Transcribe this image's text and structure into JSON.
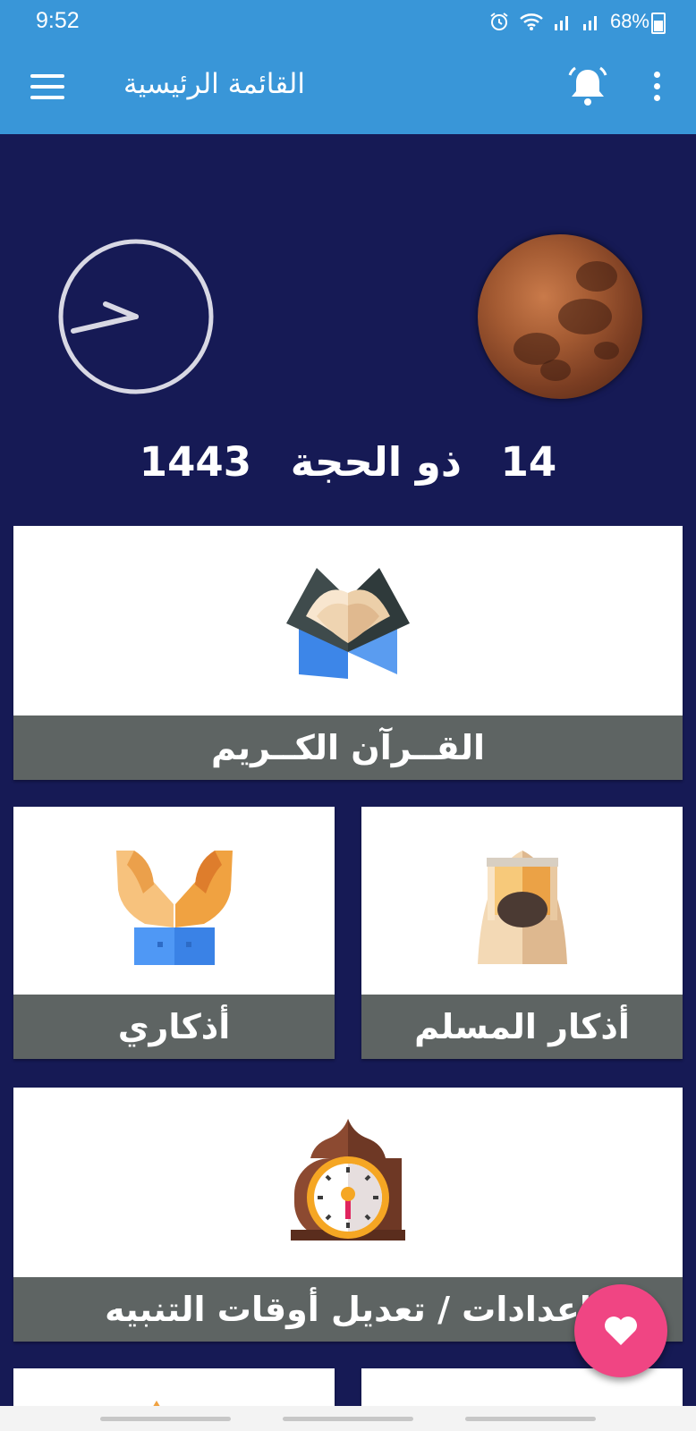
{
  "status_bar": {
    "time": "9:52",
    "battery": "68%",
    "icons": [
      "alarm-icon",
      "wifi-icon",
      "signal-icon",
      "signal-icon",
      "battery-icon"
    ]
  },
  "toolbar": {
    "title": "القائمة الرئيسية",
    "icons": [
      "menu-icon",
      "moon-icon",
      "bell-icon",
      "more-vert-icon"
    ]
  },
  "hero": {
    "hijri_day": "14",
    "hijri_month": "ذو الحجة",
    "hijri_year": "1443"
  },
  "cards": {
    "quran": {
      "label": "القــرآن الكــريم",
      "icon": "quran-icon"
    },
    "azkar_muslim": {
      "label": "أذكار المسلم",
      "icon": "muslim-man-icon"
    },
    "my_azkar": {
      "label": "أذكاري",
      "icon": "praying-hands-icon"
    },
    "alert_settings": {
      "label": "إعدادات / تعديل أوقات التنبيه",
      "icon": "mosque-clock-icon"
    }
  },
  "fab": {
    "icon": "heart-icon"
  },
  "colors": {
    "toolbar": "#3996d8",
    "background": "#161a55",
    "card_label": "#5e6463",
    "fab": "#f04583"
  }
}
